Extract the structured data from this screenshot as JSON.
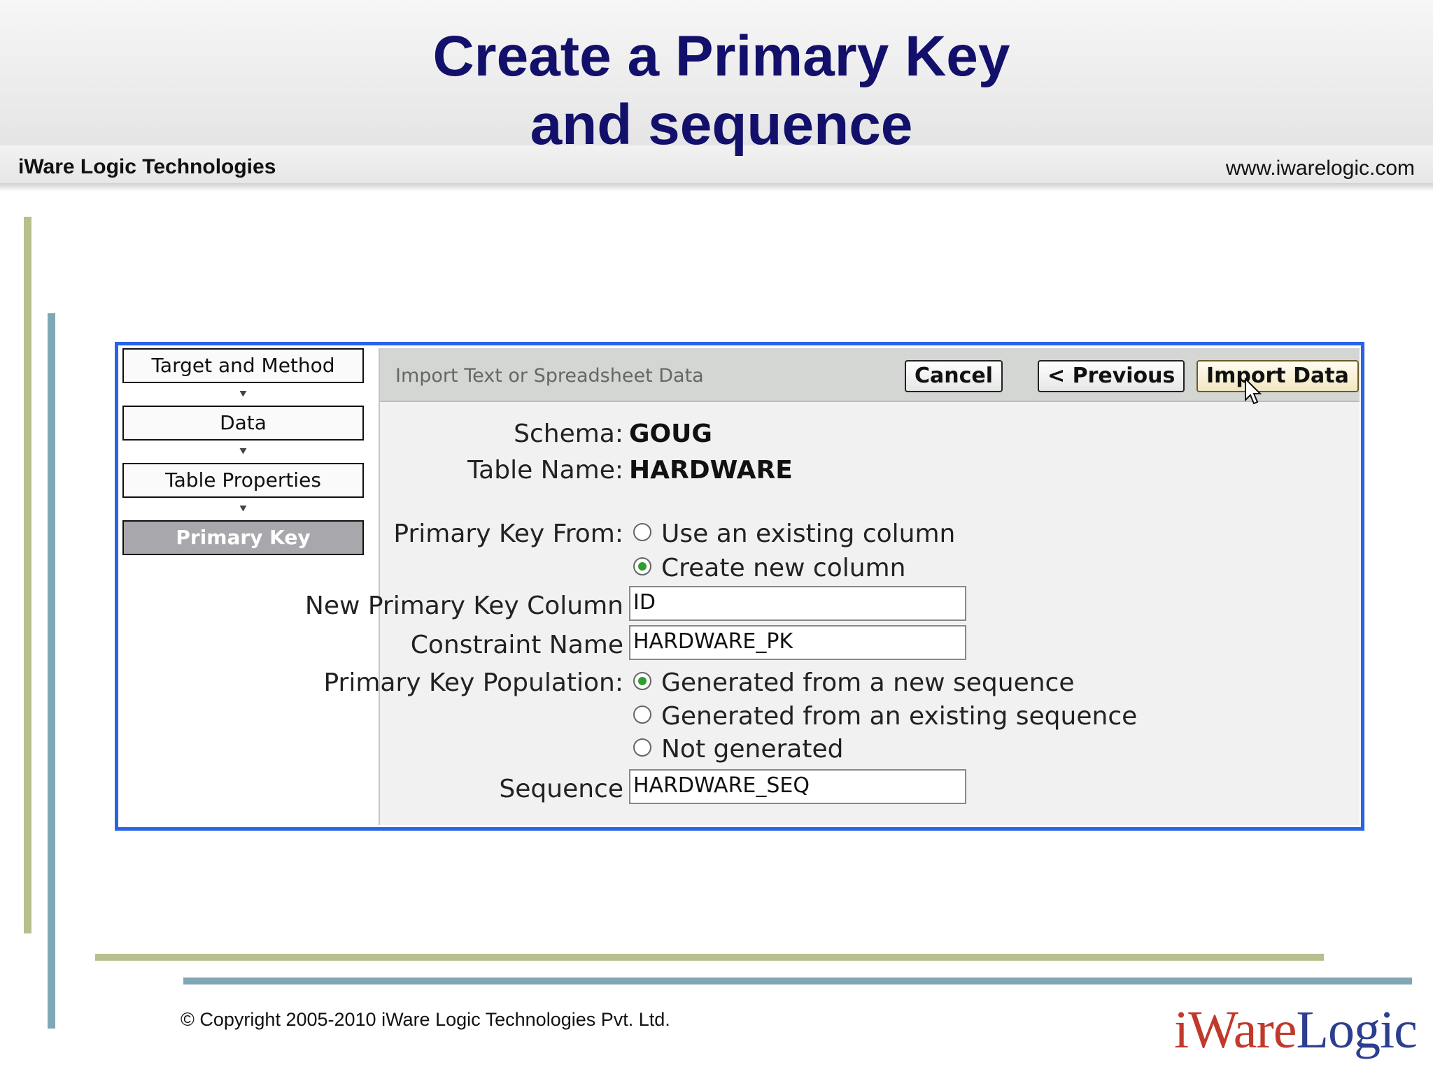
{
  "slide": {
    "title_line1": "Create a Primary Key",
    "title_line2": "and sequence",
    "company": "iWare Logic Technologies",
    "url": "www.iwarelogic.com",
    "copyright": "© Copyright 2005-2010 iWare Logic Technologies Pvt. Ltd.",
    "logo_part1": "iWare",
    "logo_part2": "Logic",
    "accent_colors": {
      "green": "#b5c08a",
      "teal": "#7fa8b4",
      "title": "#12106a"
    }
  },
  "wizard": {
    "steps": [
      {
        "label": "Target and Method",
        "active": false
      },
      {
        "label": "Data",
        "active": false
      },
      {
        "label": "Table Properties",
        "active": false
      },
      {
        "label": "Primary Key",
        "active": true
      }
    ],
    "arrow_icon": "chevron-down-icon"
  },
  "panel": {
    "title": "Import Text or Spreadsheet Data",
    "buttons": {
      "cancel": "Cancel",
      "previous": "< Previous",
      "import": "Import Data"
    },
    "schema_label": "Schema:",
    "schema_value": "GOUG",
    "table_label": "Table Name:",
    "table_value": "HARDWARE",
    "pk_from_label": "Primary Key From:",
    "pk_from_options": [
      "Use an existing column",
      "Create new column"
    ],
    "pk_from_selected": 1,
    "new_pk_col_label": "New Primary Key Column",
    "new_pk_col_value": "ID",
    "constraint_label": "Constraint Name",
    "constraint_value": "HARDWARE_PK",
    "pk_pop_label": "Primary Key Population:",
    "pk_pop_options": [
      "Generated from a new sequence",
      "Generated from an existing sequence",
      "Not generated"
    ],
    "pk_pop_selected": 0,
    "sequence_label": "Sequence",
    "sequence_value": "HARDWARE_SEQ"
  }
}
